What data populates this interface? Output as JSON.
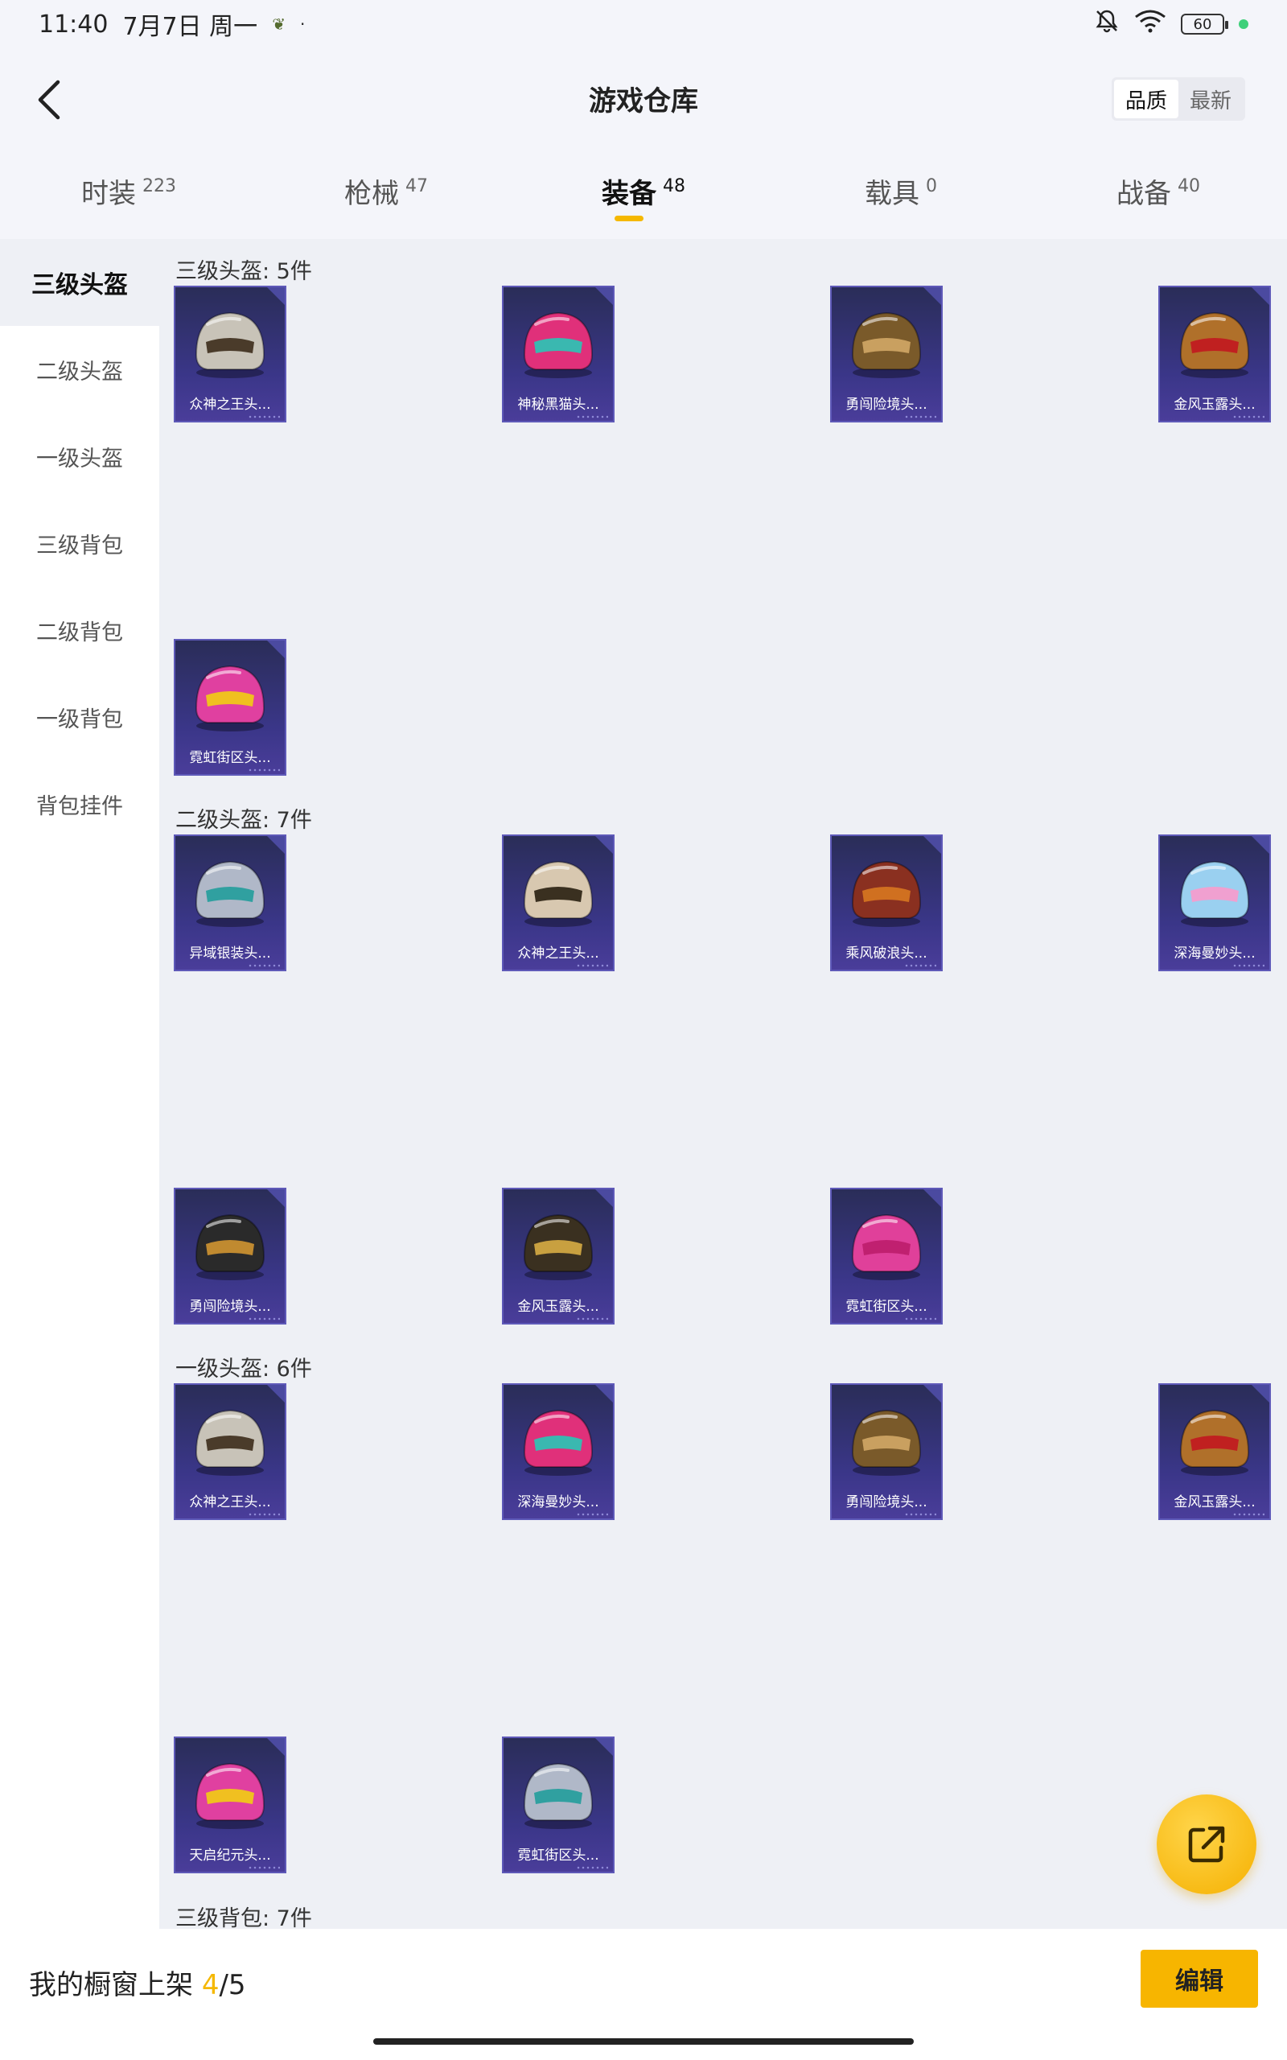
{
  "status_bar": {
    "time": "11:40",
    "date": "7月7日 周一",
    "battery": "60"
  },
  "header": {
    "title": "游戏仓库",
    "sort_options": [
      "品质",
      "最新"
    ]
  },
  "tabs": [
    {
      "label": "时装",
      "count": "223"
    },
    {
      "label": "枪械",
      "count": "47"
    },
    {
      "label": "装备",
      "count": "48"
    },
    {
      "label": "载具",
      "count": "0"
    },
    {
      "label": "战备",
      "count": "40"
    }
  ],
  "sidebar": {
    "items": [
      "三级头盔",
      "二级头盔",
      "一级头盔",
      "三级背包",
      "二级背包",
      "一级背包",
      "背包挂件"
    ]
  },
  "sections": [
    {
      "title": "三级头盔: 5件",
      "items": [
        "众神之王头...",
        "神秘黑猫头...",
        "勇闯险境头...",
        "金风玉露头...",
        "霓虹街区头..."
      ]
    },
    {
      "title": "二级头盔: 7件",
      "items": [
        "异域银装头...",
        "众神之王头...",
        "乘风破浪头...",
        "深海曼妙头...",
        "勇闯险境头...",
        "金风玉露头...",
        "霓虹街区头..."
      ]
    },
    {
      "title": "一级头盔: 6件",
      "items": [
        "众神之王头...",
        "深海曼妙头...",
        "勇闯险境头...",
        "金风玉露头...",
        "天启纪元头...",
        "霓虹街区头..."
      ]
    },
    {
      "title": "三级背包: 7件",
      "items": []
    }
  ],
  "bottom_bar": {
    "showcase_label": "我的橱窗上架",
    "showcase_current": "4",
    "showcase_total": "/5",
    "edit_label": "编辑"
  },
  "colors": {
    "accent": "#f5b800",
    "card_bg": "#3a3688",
    "content_bg": "#eef0f5"
  }
}
